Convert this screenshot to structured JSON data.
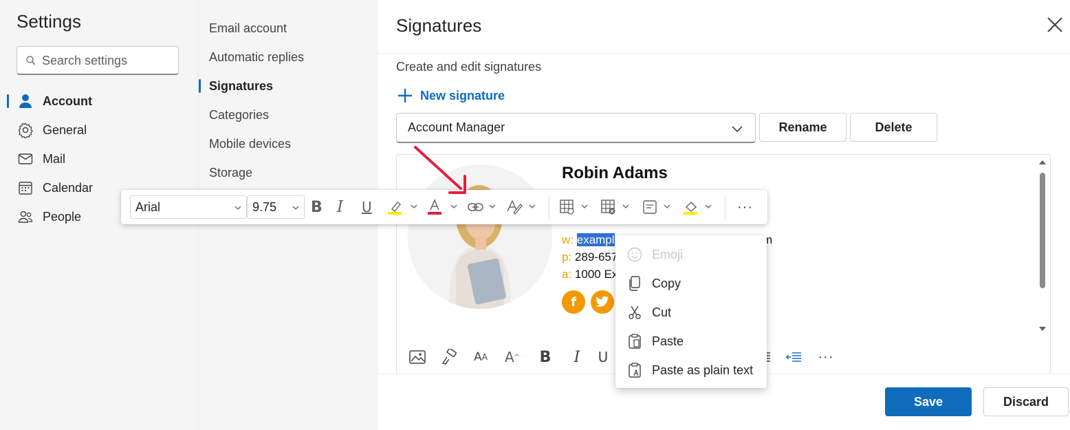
{
  "settings": {
    "title": "Settings",
    "search_placeholder": "Search settings",
    "items": [
      {
        "label": "Account",
        "icon": "person-icon",
        "active": true
      },
      {
        "label": "General",
        "icon": "gear-icon"
      },
      {
        "label": "Mail",
        "icon": "mail-icon"
      },
      {
        "label": "Calendar",
        "icon": "calendar-icon"
      },
      {
        "label": "People",
        "icon": "people-icon"
      }
    ]
  },
  "account_nav": {
    "items": [
      {
        "label": "Email account"
      },
      {
        "label": "Automatic replies"
      },
      {
        "label": "Signatures",
        "active": true
      },
      {
        "label": "Categories"
      },
      {
        "label": "Mobile devices"
      },
      {
        "label": "Storage"
      }
    ]
  },
  "page": {
    "title": "Signatures",
    "subtitle": "Create and edit signatures",
    "new_signature": "New signature",
    "selected_signature": "Account Manager",
    "rename": "Rename",
    "delete": "Delete",
    "save": "Save",
    "discard": "Discard"
  },
  "signature": {
    "name": "Robin Adams",
    "w_key": "w:",
    "w_selected": "exampl",
    "w_rest": "m",
    "p_key": "p:",
    "p_val": "289-657",
    "a_key": "a:",
    "a_val": "1000 Ex",
    "social": [
      "f",
      "t"
    ]
  },
  "format_toolbar": {
    "font": "Arial",
    "size": "9.75"
  },
  "context_menu": {
    "items": [
      {
        "label": "Emoji",
        "icon": "emoji-icon",
        "disabled": true
      },
      {
        "label": "Copy",
        "icon": "copy-icon"
      },
      {
        "label": "Cut",
        "icon": "scissors-icon"
      },
      {
        "label": "Paste",
        "icon": "paste-icon"
      },
      {
        "label": "Paste as plain text",
        "icon": "paste-text-icon"
      }
    ]
  },
  "colors": {
    "accent": "#0f6cbd",
    "signature_accent": "#f29900",
    "selection": "#2f6fd6",
    "annotation_arrow": "#e3203c"
  }
}
